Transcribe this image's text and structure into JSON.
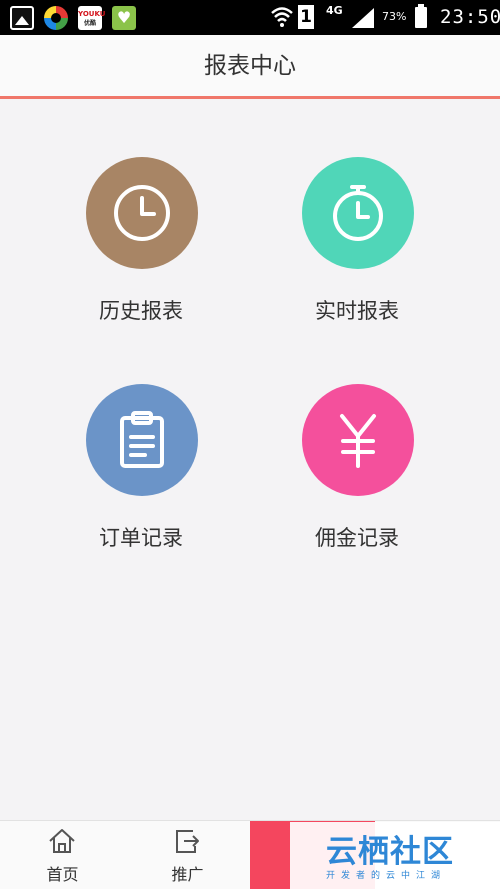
{
  "status_bar": {
    "youku_label": "YOUKU",
    "youku_sub": "优酷",
    "sim_slot": "1",
    "network": "4G",
    "battery": "73%",
    "time": "23:50"
  },
  "header": {
    "title": "报表中心"
  },
  "cards": [
    {
      "label": "历史报表",
      "color": "#a88565",
      "icon": "clock-icon"
    },
    {
      "label": "实时报表",
      "color": "#50d6b8",
      "icon": "stopwatch-icon"
    },
    {
      "label": "订单记录",
      "color": "#6b94c8",
      "icon": "clipboard-icon"
    },
    {
      "label": "佣金记录",
      "color": "#f4509c",
      "icon": "yen-icon"
    }
  ],
  "bottom_nav": {
    "items": [
      {
        "label": "首页",
        "icon": "home-icon"
      },
      {
        "label": "推广",
        "icon": "share-icon"
      }
    ],
    "active_color": "#f4465e"
  },
  "watermark": {
    "main": "云栖社区",
    "sub": "开发者的云中江湖"
  }
}
